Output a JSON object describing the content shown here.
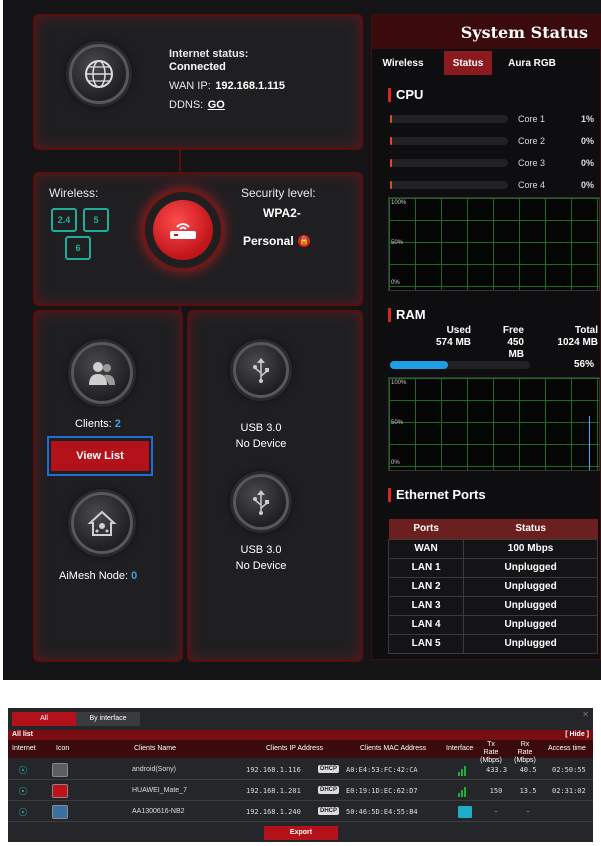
{
  "internet": {
    "status_label": "Internet status:",
    "status_value": "Connected",
    "wan_ip_label": "WAN IP:",
    "wan_ip": "192.168.1.115",
    "ddns_label": "DDNS:",
    "ddns_link": "GO"
  },
  "wireless": {
    "label": "Wireless:",
    "bands": [
      "2.4",
      "5",
      "6"
    ],
    "security_label": "Security level:",
    "security_value_1": "WPA2-",
    "security_value_2": "Personal"
  },
  "clients": {
    "label": "Clients:",
    "count": "2",
    "button": "View List"
  },
  "aimesh": {
    "label": "AiMesh Node:",
    "count": "0"
  },
  "usb": [
    {
      "type": "USB 3.0",
      "status": "No Device"
    },
    {
      "type": "USB 3.0",
      "status": "No Device"
    }
  ],
  "system_status": {
    "title": "System Status",
    "tabs": [
      "Wireless",
      "Status",
      "Aura RGB"
    ],
    "active_tab": "Status",
    "cpu": {
      "title": "CPU",
      "cores": [
        {
          "name": "Core 1",
          "value": "1%",
          "level": 0.01
        },
        {
          "name": "Core 2",
          "value": "0%",
          "level": 0
        },
        {
          "name": "Core 3",
          "value": "0%",
          "level": 0
        },
        {
          "name": "Core 4",
          "value": "0%",
          "level": 0
        }
      ],
      "graph_ticks": [
        "100%",
        "50%",
        "0%"
      ]
    },
    "ram": {
      "title": "RAM",
      "used_label": "Used",
      "used": "574 MB",
      "free_label": "Free",
      "free": "450 MB",
      "total_label": "Total",
      "total": "1024 MB",
      "percent": "56%",
      "level": 0.56,
      "graph_ticks": [
        "100%",
        "50%",
        "0%"
      ]
    },
    "ethernet": {
      "title": "Ethernet Ports",
      "headers": [
        "Ports",
        "Status"
      ],
      "rows": [
        [
          "WAN",
          "100 Mbps"
        ],
        [
          "LAN 1",
          "Unplugged"
        ],
        [
          "LAN 2",
          "Unplugged"
        ],
        [
          "LAN 3",
          "Unplugged"
        ],
        [
          "LAN 4",
          "Unplugged"
        ],
        [
          "LAN 5",
          "Unplugged"
        ]
      ]
    }
  },
  "client_list": {
    "tabs": [
      "All",
      "By interface"
    ],
    "list_label": "All list",
    "hide_link": "[ Hide ]",
    "headers": [
      "Internet",
      "Icon",
      "Clients Name",
      "Clients IP Address",
      "Clients MAC Address",
      "Interface",
      "Tx Rate (Mbps)",
      "Rx Rate (Mbps)",
      "Access time"
    ],
    "rows": [
      {
        "name": "android(Sony)",
        "ip": "192.168.1.116",
        "dhcp": "DHCP",
        "mac": "A0:E4:53:FC:42:CA",
        "tx": "433.3",
        "rx": "40.5",
        "time": "02:50:55"
      },
      {
        "name": "HUAWEI_Mate_7",
        "ip": "192.168.1.201",
        "dhcp": "DHCP",
        "mac": "E0:19:1D:EC:62:D7",
        "tx": "150",
        "rx": "13.5",
        "time": "02:31:02"
      },
      {
        "name": "AA1300616-NB2",
        "ip": "192.168.1.240",
        "dhcp": "DHCP",
        "mac": "50:46:5D:E4:55:B4",
        "tx": "-",
        "rx": "-",
        "time": ""
      }
    ],
    "export_button": "Export",
    "colors": {
      "accent": "#b3121a",
      "internet_icon": "#1fb4a8"
    }
  }
}
